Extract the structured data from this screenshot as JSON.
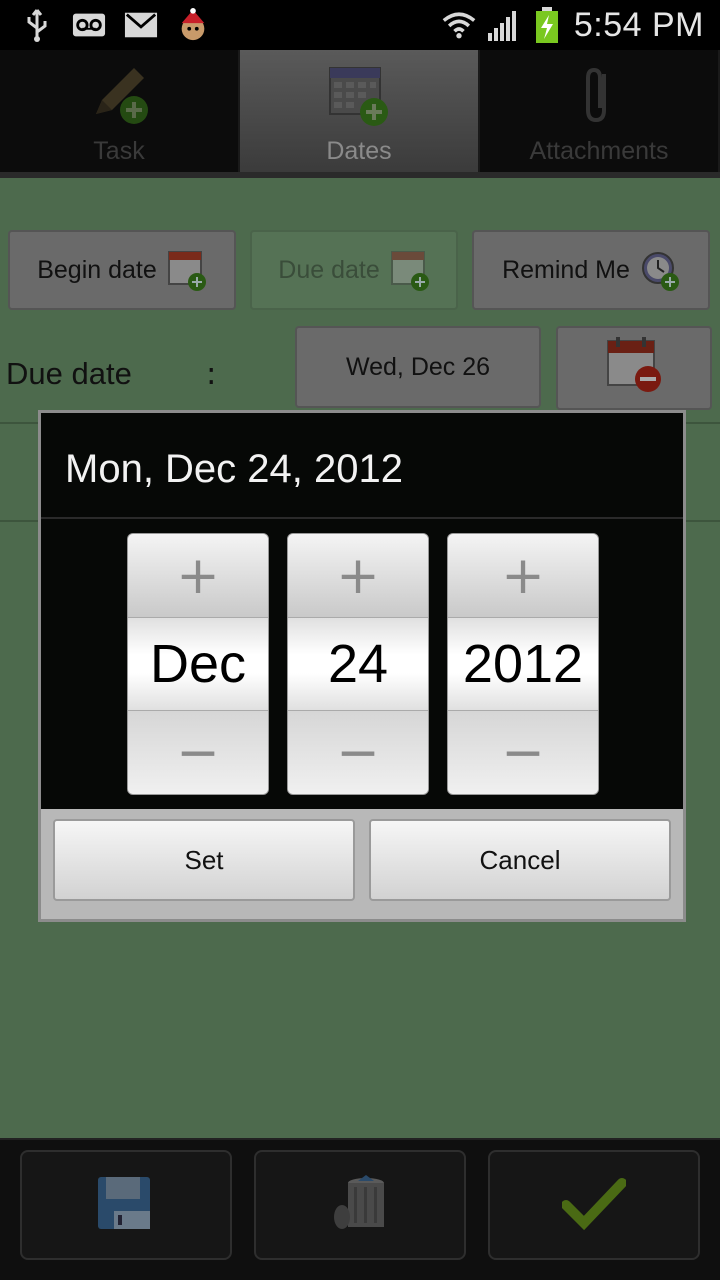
{
  "status_bar": {
    "left_icons": [
      "usb-icon",
      "voicemail-icon",
      "gmail-icon",
      "elf-app-icon"
    ],
    "right_icons": [
      "wifi-icon",
      "signal-icon",
      "battery-charging-icon"
    ],
    "time": "5:54 PM"
  },
  "tabs": [
    {
      "label": "Task",
      "icon": "pencil-add-icon",
      "active": false
    },
    {
      "label": "Dates",
      "icon": "calendar-add-icon",
      "active": true
    },
    {
      "label": "Attachments",
      "icon": "paperclip-icon",
      "active": false
    }
  ],
  "main": {
    "begin_date_label": "Begin date",
    "due_date_button_label": "Due date",
    "remind_me_label": "Remind Me",
    "due_date_field_label": "Due date",
    "due_date_colon": ":",
    "due_date_value": "Wed, Dec 26"
  },
  "dialog": {
    "title": "Mon, Dec 24, 2012",
    "month": "Dec",
    "day": "24",
    "year": "2012",
    "plus": "+",
    "minus": "−",
    "set_label": "Set",
    "cancel_label": "Cancel"
  },
  "bottom_bar": {
    "icons": [
      "save-icon",
      "trash-icon",
      "checkmark-icon"
    ]
  },
  "colors": {
    "main_background": "#4d6a4d",
    "dialog_background": "#060806",
    "accent_green": "#6a9a1a"
  }
}
